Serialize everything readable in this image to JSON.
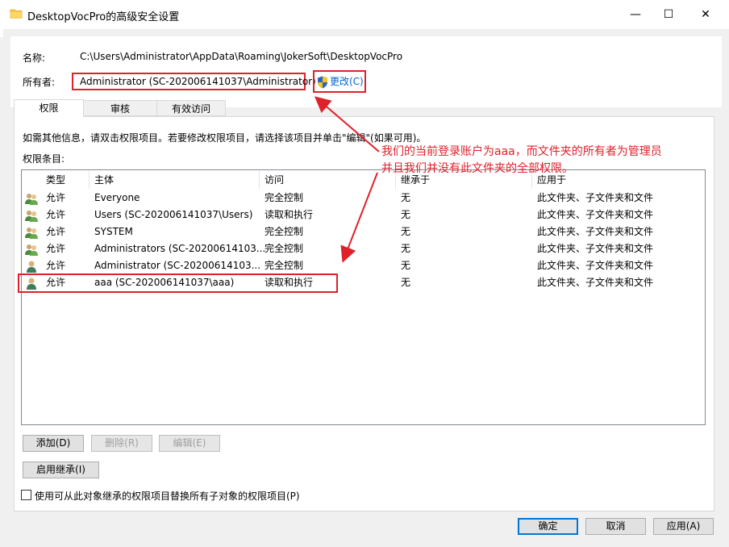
{
  "window": {
    "title": "DesktopVocPro的高级安全设置",
    "minimize": "—",
    "maximize": "☐",
    "close": "✕"
  },
  "header": {
    "name_label": "名称:",
    "name_value": "C:\\Users\\Administrator\\AppData\\Roaming\\JokerSoft\\DesktopVocPro",
    "owner_label": "所有者:",
    "owner_value": "Administrator (SC-202006141037\\Administrator)",
    "change_link": "更改(C)"
  },
  "tabs": [
    {
      "label": "权限",
      "active": true
    },
    {
      "label": "审核",
      "active": false
    },
    {
      "label": "有效访问",
      "active": false
    }
  ],
  "panel": {
    "info_text": "如需其他信息，请双击权限项目。若要修改权限项目，请选择该项目并单击\"编辑\"(如果可用)。",
    "entries_label": "权限条目:"
  },
  "columns": [
    "类型",
    "主体",
    "访问",
    "继承于",
    "应用于"
  ],
  "rows": [
    {
      "icon": "group-users-icon",
      "type": "允许",
      "principal": "Everyone",
      "access": "完全控制",
      "inherited": "无",
      "applies": "此文件夹、子文件夹和文件"
    },
    {
      "icon": "group-users-icon",
      "type": "允许",
      "principal": "Users (SC-202006141037\\Users)",
      "access": "读取和执行",
      "inherited": "无",
      "applies": "此文件夹、子文件夹和文件"
    },
    {
      "icon": "group-users-icon",
      "type": "允许",
      "principal": "SYSTEM",
      "access": "完全控制",
      "inherited": "无",
      "applies": "此文件夹、子文件夹和文件"
    },
    {
      "icon": "group-users-icon",
      "type": "允许",
      "principal": "Administrators (SC-20200614103...",
      "access": "完全控制",
      "inherited": "无",
      "applies": "此文件夹、子文件夹和文件"
    },
    {
      "icon": "single-user-icon",
      "type": "允许",
      "principal": "Administrator (SC-20200614103...",
      "access": "完全控制",
      "inherited": "无",
      "applies": "此文件夹、子文件夹和文件"
    },
    {
      "icon": "single-user-icon",
      "type": "允许",
      "principal": "aaa (SC-202006141037\\aaa)",
      "access": "读取和执行",
      "inherited": "无",
      "applies": "此文件夹、子文件夹和文件"
    }
  ],
  "annotation": {
    "line1": "我们的当前登录账户为aaa，而文件夹的所有者为管理员",
    "line2": "并且我们并没有此文件夹的全部权限。"
  },
  "buttons": {
    "add": "添加(D)",
    "remove": "删除(R)",
    "edit": "编辑(E)",
    "enable_inheritance": "启用继承(I)",
    "ok": "确定",
    "cancel": "取消",
    "apply": "应用(A)"
  },
  "checkbox": {
    "label": "使用可从此对象继承的权限项目替换所有子对象的权限项目(P)",
    "checked": false
  },
  "colors": {
    "annotation_red": "#e0202a",
    "link_blue": "#0066cc",
    "focus_blue": "#0078d7"
  }
}
